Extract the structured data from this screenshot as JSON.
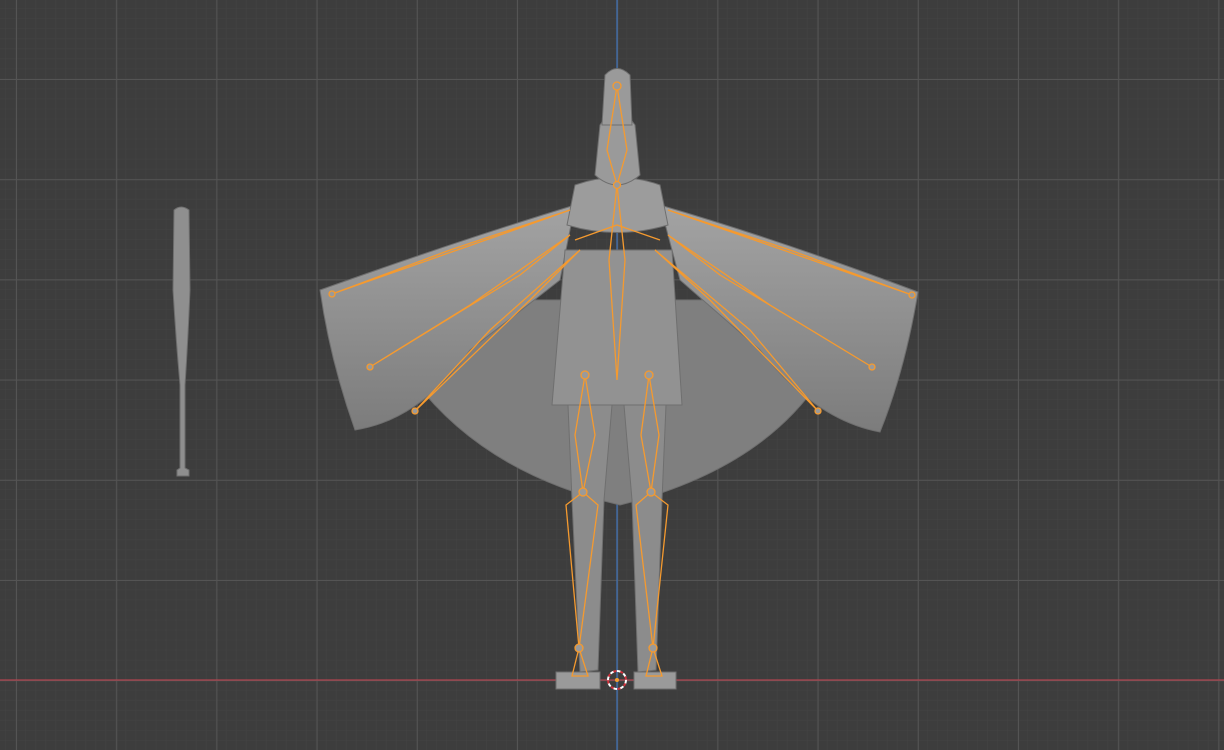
{
  "viewport": {
    "view": "front-orthographic",
    "colors": {
      "background": "#3d3d3d",
      "grid_minor": "#434343",
      "grid_major": "#545454",
      "x_axis": "#b0444f",
      "z_axis": "#3f72b8",
      "mesh": "#8e8e8e",
      "armature_selected": "#f59a2f"
    }
  },
  "objects": [
    {
      "name_icon": "character-mesh",
      "type": "mesh"
    },
    {
      "name_icon": "armature",
      "type": "armature",
      "selected": true
    },
    {
      "name_icon": "baseball-bat-mesh",
      "type": "mesh"
    },
    {
      "name_icon": "3d-cursor-icon",
      "type": "cursor"
    }
  ]
}
